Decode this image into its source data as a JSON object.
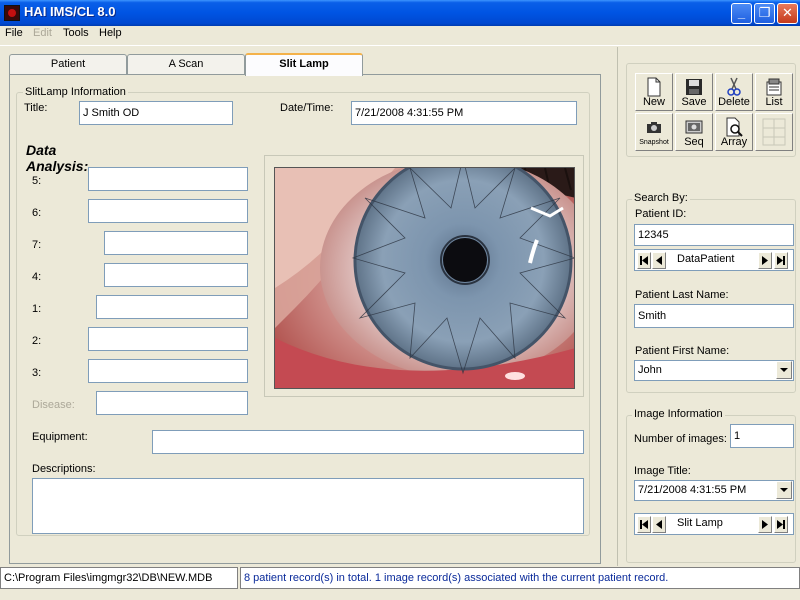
{
  "window": {
    "title": "HAI IMS/CL 8.0",
    "minimize": "_",
    "maximize": "❐",
    "close": "✕"
  },
  "menu": {
    "file": "File",
    "edit": "Edit",
    "tools": "Tools",
    "help": "Help"
  },
  "tabs": {
    "patient": "Patient",
    "ascan": "A Scan",
    "slitlamp": "Slit Lamp"
  },
  "slitlamp": {
    "group_label": "SlitLamp Information",
    "title_label": "Title:",
    "title_value": "J Smith OD",
    "datetime_label": "Date/Time:",
    "datetime_value": "7/21/2008 4:31:55 PM",
    "analysis_heading": "Data Analysis:",
    "rows": [
      {
        "label": "5:",
        "value": ""
      },
      {
        "label": "6:",
        "value": ""
      },
      {
        "label": "7:",
        "value": ""
      },
      {
        "label": "4:",
        "value": ""
      },
      {
        "label": "1:",
        "value": ""
      },
      {
        "label": "2:",
        "value": ""
      },
      {
        "label": "3:",
        "value": ""
      }
    ],
    "disease_label": "Disease:",
    "disease_value": "",
    "equipment_label": "Equipment:",
    "equipment_value": "",
    "descriptions_label": "Descriptions:",
    "descriptions_value": ""
  },
  "toolbar": {
    "new": "New",
    "save": "Save",
    "delete": "Delete",
    "list": "List",
    "snapshot": "Snapshot",
    "seq": "Seq",
    "array": "Array"
  },
  "search": {
    "group_label": "Search By:",
    "patient_id_label": "Patient ID:",
    "patient_id_value": "12345",
    "nav_source": "DataPatient",
    "last_name_label": "Patient Last Name:",
    "last_name_value": "Smith",
    "first_name_label": "Patient First Name:",
    "first_name_value": "John"
  },
  "image_info": {
    "group_label": "Image Information",
    "count_label": "Number of images:",
    "count_value": "1",
    "title_label": "Image Title:",
    "title_value": "7/21/2008 4:31:55 PM",
    "nav_source": "Slit Lamp"
  },
  "status": {
    "path": "C:\\Program Files\\imgmgr32\\DB\\NEW.MDB",
    "message": "8 patient record(s) in total. 1 image record(s) associated with the current patient record.",
    "message_color": "#0a2a9a"
  }
}
